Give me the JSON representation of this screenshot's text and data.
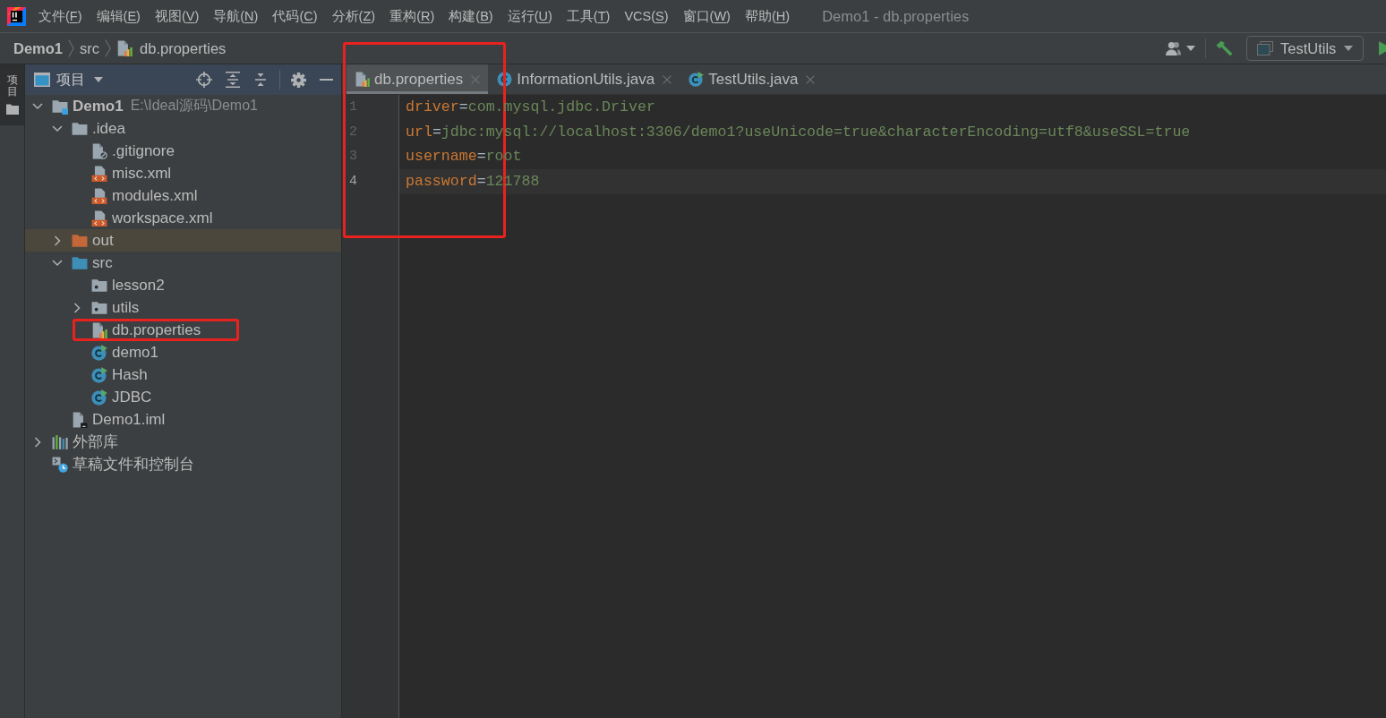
{
  "menu_bar": {
    "items": [
      {
        "before": "文件(",
        "mnemonic": "F",
        "after": ")"
      },
      {
        "before": "编辑(",
        "mnemonic": "E",
        "after": ")"
      },
      {
        "before": "视图(",
        "mnemonic": "V",
        "after": ")"
      },
      {
        "before": "导航(",
        "mnemonic": "N",
        "after": ")"
      },
      {
        "before": "代码(",
        "mnemonic": "C",
        "after": ")"
      },
      {
        "before": "分析(",
        "mnemonic": "Z",
        "after": ")"
      },
      {
        "before": "重构(",
        "mnemonic": "R",
        "after": ")"
      },
      {
        "before": "构建(",
        "mnemonic": "B",
        "after": ")"
      },
      {
        "before": "运行(",
        "mnemonic": "U",
        "after": ")"
      },
      {
        "before": "工具(",
        "mnemonic": "T",
        "after": ")"
      },
      {
        "before": "VCS(",
        "mnemonic": "S",
        "after": ")"
      },
      {
        "before": "窗口(",
        "mnemonic": "W",
        "after": ")"
      },
      {
        "before": "帮助(",
        "mnemonic": "H",
        "after": ")"
      }
    ],
    "title": "Demo1 - db.properties"
  },
  "navigation_bar": {
    "breadcrumbs": [
      {
        "label": "Demo1",
        "kind": "project"
      },
      {
        "label": "src",
        "kind": "folder"
      },
      {
        "label": "db.properties",
        "kind": "properties"
      }
    ],
    "run_configuration": {
      "label": "TestUtils"
    }
  },
  "tool_stripe": {
    "tabs": [
      {
        "label": "项目",
        "selected": true
      }
    ]
  },
  "project_panel": {
    "title": "项目",
    "tree": [
      {
        "label": "Demo1",
        "kind": "module",
        "path": "E:\\Ideal源码\\Demo1",
        "expanded": true,
        "excluded": false,
        "highlighted": false,
        "children": [
          {
            "label": ".idea",
            "kind": "folder",
            "expanded": true,
            "excluded": false,
            "highlighted": false,
            "children": [
              {
                "label": ".gitignore",
                "kind": "ignore",
                "excluded": false,
                "highlighted": false
              },
              {
                "label": "misc.xml",
                "kind": "xml",
                "excluded": false,
                "highlighted": false
              },
              {
                "label": "modules.xml",
                "kind": "xml",
                "excluded": false,
                "highlighted": false
              },
              {
                "label": "workspace.xml",
                "kind": "xml",
                "excluded": false,
                "highlighted": false
              }
            ]
          },
          {
            "label": "out",
            "kind": "folder",
            "expanded": false,
            "excluded": true,
            "highlighted": false
          },
          {
            "label": "src",
            "kind": "source-folder",
            "expanded": true,
            "excluded": false,
            "highlighted": false,
            "children": [
              {
                "label": "lesson2",
                "kind": "package",
                "excluded": false,
                "highlighted": false
              },
              {
                "label": "utils",
                "kind": "package",
                "expanded": false,
                "excluded": false,
                "highlighted": false
              },
              {
                "label": "db.properties",
                "kind": "properties",
                "excluded": false,
                "highlighted": true
              },
              {
                "label": "demo1",
                "kind": "runnable-class",
                "excluded": false,
                "highlighted": false
              },
              {
                "label": "Hash",
                "kind": "runnable-class",
                "excluded": false,
                "highlighted": false
              },
              {
                "label": "JDBC",
                "kind": "runnable-class",
                "excluded": false,
                "highlighted": false
              }
            ]
          },
          {
            "label": "Demo1.iml",
            "kind": "iml",
            "excluded": false,
            "highlighted": false
          }
        ]
      },
      {
        "label": "外部库",
        "kind": "library",
        "expanded": false,
        "excluded": false,
        "highlighted": false
      },
      {
        "label": "草稿文件和控制台",
        "kind": "scratch",
        "excluded": false,
        "highlighted": false
      }
    ]
  },
  "editor": {
    "highlighted": true,
    "tabs": [
      {
        "label": "db.properties",
        "kind": "properties",
        "selected": true
      },
      {
        "label": "InformationUtils.java",
        "kind": "class",
        "selected": false
      },
      {
        "label": "TestUtils.java",
        "kind": "runnable-class",
        "selected": false
      }
    ],
    "lines": [
      {
        "number": "1",
        "current": false,
        "tokens": [
          {
            "kind": "key",
            "text": "driver"
          },
          {
            "kind": "operator",
            "text": "="
          },
          {
            "kind": "value",
            "text": "com.mysql.jdbc.Driver"
          }
        ]
      },
      {
        "number": "2",
        "current": false,
        "tokens": [
          {
            "kind": "key",
            "text": "url"
          },
          {
            "kind": "operator",
            "text": "="
          },
          {
            "kind": "value",
            "text": "jdbc:mysql://localhost:3306/demo1?useUnicode=true&characterEncoding=utf8&useSSL=true"
          }
        ]
      },
      {
        "number": "3",
        "current": false,
        "tokens": [
          {
            "kind": "key",
            "text": "username"
          },
          {
            "kind": "operator",
            "text": "="
          },
          {
            "kind": "value",
            "text": "root"
          }
        ]
      },
      {
        "number": "4",
        "current": true,
        "tokens": [
          {
            "kind": "key",
            "text": "password"
          },
          {
            "kind": "operator",
            "text": "="
          },
          {
            "kind": "value",
            "text": "121788"
          }
        ]
      }
    ]
  }
}
